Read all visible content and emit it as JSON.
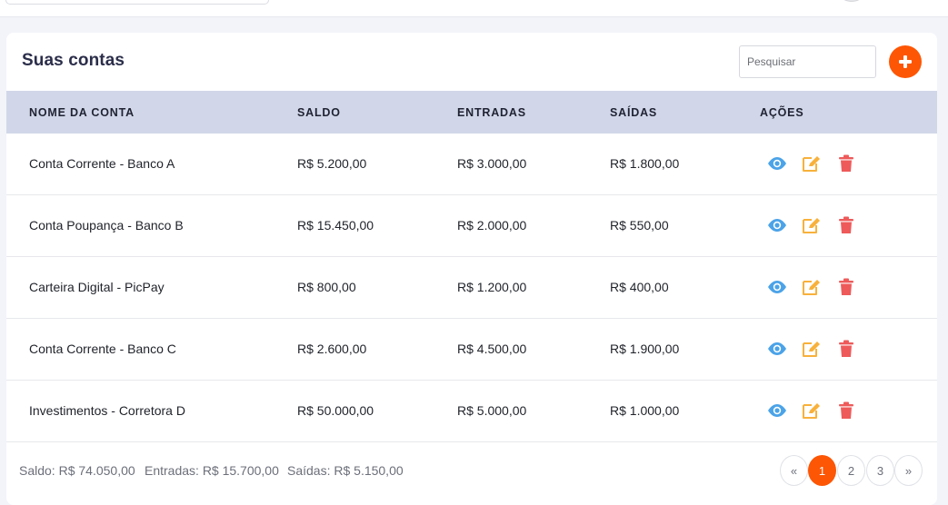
{
  "accounts": {
    "title": "Suas contas",
    "search_placeholder": "Pesquisar",
    "columns": [
      "NOME DA CONTA",
      "SALDO",
      "ENTRADAS",
      "SAÍDAS",
      "AÇÕES"
    ],
    "rows": [
      {
        "name": "Conta Corrente - Banco A",
        "saldo": "R$ 5.200,00",
        "entradas": "R$ 3.000,00",
        "saidas": "R$ 1.800,00"
      },
      {
        "name": "Conta Poupança - Banco B",
        "saldo": "R$ 15.450,00",
        "entradas": "R$ 2.000,00",
        "saidas": "R$ 550,00"
      },
      {
        "name": "Carteira Digital - PicPay",
        "saldo": "R$ 800,00",
        "entradas": "R$ 1.200,00",
        "saidas": "R$ 400,00"
      },
      {
        "name": "Conta Corrente - Banco C",
        "saldo": "R$ 2.600,00",
        "entradas": "R$ 4.500,00",
        "saidas": "R$ 1.900,00"
      },
      {
        "name": "Investimentos - Corretora D",
        "saldo": "R$ 50.000,00",
        "entradas": "R$ 5.000,00",
        "saidas": "R$ 1.000,00"
      }
    ],
    "totals": {
      "saldo": "Saldo: R$ 74.050,00",
      "entradas": "Entradas: R$ 15.700,00",
      "saidas": "Saídas: R$ 5.150,00"
    },
    "pagination": {
      "prev": "«",
      "pages": [
        "1",
        "2",
        "3"
      ],
      "active_page": "1",
      "next": "»"
    }
  },
  "icons": {
    "add": "plus-icon",
    "view": "eye-icon",
    "edit": "edit-icon",
    "delete": "trash-icon"
  },
  "colors": {
    "accent": "#fd5604",
    "header_bg": "#d1d7e8",
    "view": "#4ba3e8",
    "edit": "#f8b13b",
    "delete": "#ee5a5a"
  }
}
